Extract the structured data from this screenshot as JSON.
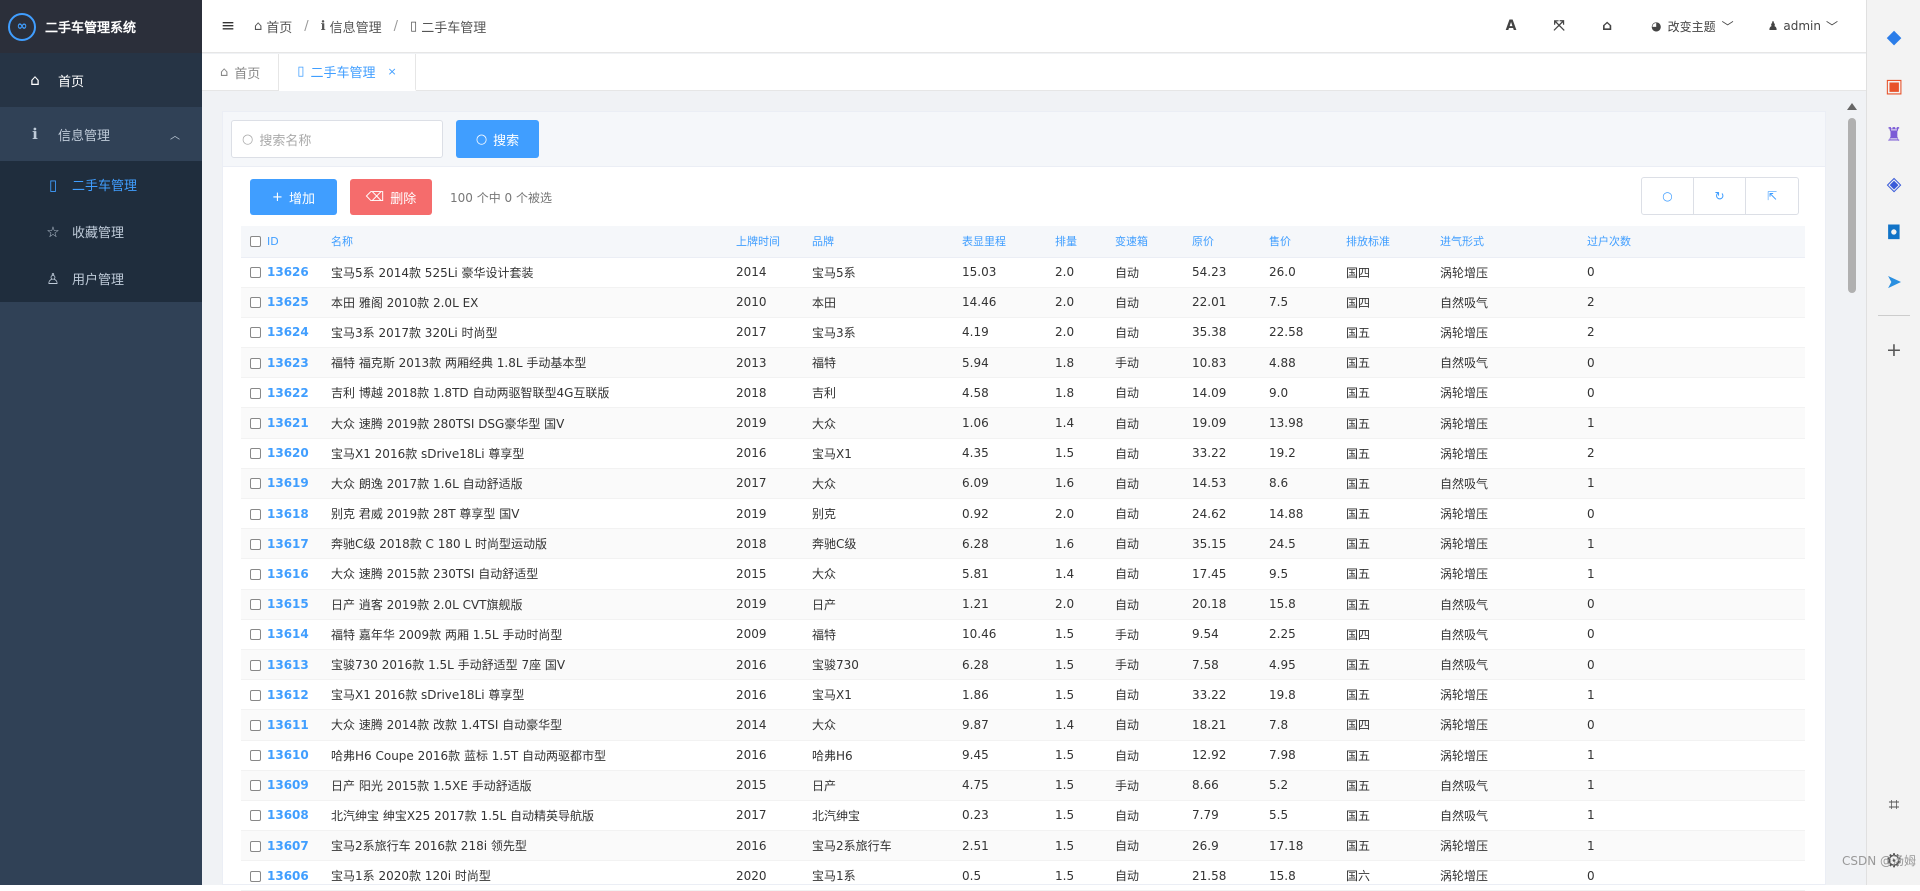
{
  "app": {
    "title": "二手车管理系统",
    "logo_glyph": "∞"
  },
  "sidebar": {
    "items": [
      {
        "label": "首页",
        "icon": "home-icon"
      },
      {
        "label": "信息管理",
        "icon": "info-icon"
      }
    ],
    "subitems": [
      {
        "label": "二手车管理",
        "icon": "file-icon"
      },
      {
        "label": "收藏管理",
        "icon": "star-icon"
      },
      {
        "label": "用户管理",
        "icon": "user-icon"
      }
    ]
  },
  "header": {
    "breadcrumb": [
      "首页",
      "信息管理",
      "二手车管理"
    ],
    "theme_label": "改变主题",
    "user_label": "admin"
  },
  "tabs": [
    {
      "label": "首页"
    },
    {
      "label": "二手车管理"
    }
  ],
  "search": {
    "placeholder": "搜索名称",
    "button_label": "搜索"
  },
  "toolbar": {
    "add_label": "增加",
    "delete_label": "删除",
    "selection_info": "100 个中 0 个被选"
  },
  "table": {
    "columns": [
      "ID",
      "名称",
      "上牌时间",
      "品牌",
      "表显里程",
      "排量",
      "变速箱",
      "原价",
      "售价",
      "排放标准",
      "进气形式",
      "过户次数"
    ],
    "rows": [
      [
        "13626",
        "宝马5系 2014款 525Li 豪华设计套装",
        "2014",
        "宝马5系",
        "15.03",
        "2.0",
        "自动",
        "54.23",
        "26.0",
        "国四",
        "涡轮增压",
        "0"
      ],
      [
        "13625",
        "本田 雅阁 2010款 2.0L EX",
        "2010",
        "本田",
        "14.46",
        "2.0",
        "自动",
        "22.01",
        "7.5",
        "国四",
        "自然吸气",
        "2"
      ],
      [
        "13624",
        "宝马3系 2017款 320Li 时尚型",
        "2017",
        "宝马3系",
        "4.19",
        "2.0",
        "自动",
        "35.38",
        "22.58",
        "国五",
        "涡轮增压",
        "2"
      ],
      [
        "13623",
        "福特 福克斯 2013款 两厢经典 1.8L 手动基本型",
        "2013",
        "福特",
        "5.94",
        "1.8",
        "手动",
        "10.83",
        "4.88",
        "国五",
        "自然吸气",
        "0"
      ],
      [
        "13622",
        "吉利 博越 2018款 1.8TD 自动两驱智联型4G互联版",
        "2018",
        "吉利",
        "4.58",
        "1.8",
        "自动",
        "14.09",
        "9.0",
        "国五",
        "涡轮增压",
        "0"
      ],
      [
        "13621",
        "大众 速腾 2019款 280TSI DSG豪华型 国V",
        "2019",
        "大众",
        "1.06",
        "1.4",
        "自动",
        "19.09",
        "13.98",
        "国五",
        "涡轮增压",
        "1"
      ],
      [
        "13620",
        "宝马X1 2016款 sDrive18Li 尊享型",
        "2016",
        "宝马X1",
        "4.35",
        "1.5",
        "自动",
        "33.22",
        "19.2",
        "国五",
        "涡轮增压",
        "2"
      ],
      [
        "13619",
        "大众 朗逸 2017款 1.6L 自动舒适版",
        "2017",
        "大众",
        "6.09",
        "1.6",
        "自动",
        "14.53",
        "8.6",
        "国五",
        "自然吸气",
        "1"
      ],
      [
        "13618",
        "别克 君威 2019款 28T 尊享型 国V",
        "2019",
        "别克",
        "0.92",
        "2.0",
        "自动",
        "24.62",
        "14.88",
        "国五",
        "涡轮增压",
        "0"
      ],
      [
        "13617",
        "奔驰C级 2018款 C 180 L 时尚型运动版",
        "2018",
        "奔驰C级",
        "6.28",
        "1.6",
        "自动",
        "35.15",
        "24.5",
        "国五",
        "涡轮增压",
        "1"
      ],
      [
        "13616",
        "大众 速腾 2015款 230TSI 自动舒适型",
        "2015",
        "大众",
        "5.81",
        "1.4",
        "自动",
        "17.45",
        "9.5",
        "国五",
        "涡轮增压",
        "1"
      ],
      [
        "13615",
        "日产 逍客 2019款 2.0L CVT旗舰版",
        "2019",
        "日产",
        "1.21",
        "2.0",
        "自动",
        "20.18",
        "15.8",
        "国五",
        "自然吸气",
        "0"
      ],
      [
        "13614",
        "福特 嘉年华 2009款 两厢 1.5L 手动时尚型",
        "2009",
        "福特",
        "10.46",
        "1.5",
        "手动",
        "9.54",
        "2.25",
        "国四",
        "自然吸气",
        "0"
      ],
      [
        "13613",
        "宝骏730 2016款 1.5L 手动舒适型 7座 国V",
        "2016",
        "宝骏730",
        "6.28",
        "1.5",
        "手动",
        "7.58",
        "4.95",
        "国五",
        "自然吸气",
        "0"
      ],
      [
        "13612",
        "宝马X1 2016款 sDrive18Li 尊享型",
        "2016",
        "宝马X1",
        "1.86",
        "1.5",
        "自动",
        "33.22",
        "19.8",
        "国五",
        "涡轮增压",
        "1"
      ],
      [
        "13611",
        "大众 速腾 2014款 改款 1.4TSI 自动豪华型",
        "2014",
        "大众",
        "9.87",
        "1.4",
        "自动",
        "18.21",
        "7.8",
        "国四",
        "涡轮增压",
        "0"
      ],
      [
        "13610",
        "哈弗H6 Coupe 2016款 蓝标 1.5T 自动两驱都市型",
        "2016",
        "哈弗H6",
        "9.45",
        "1.5",
        "自动",
        "12.92",
        "7.98",
        "国五",
        "涡轮增压",
        "1"
      ],
      [
        "13609",
        "日产 阳光 2015款 1.5XE 手动舒适版",
        "2015",
        "日产",
        "4.75",
        "1.5",
        "手动",
        "8.66",
        "5.2",
        "国五",
        "自然吸气",
        "1"
      ],
      [
        "13608",
        "北汽绅宝 绅宝X25 2017款 1.5L 自动精英导航版",
        "2017",
        "北汽绅宝",
        "0.23",
        "1.5",
        "自动",
        "7.79",
        "5.5",
        "国五",
        "自然吸气",
        "1"
      ],
      [
        "13607",
        "宝马2系旅行车 2016款 218i 领先型",
        "2016",
        "宝马2系旅行车",
        "2.51",
        "1.5",
        "自动",
        "26.9",
        "17.18",
        "国五",
        "涡轮增压",
        "1"
      ],
      [
        "13606",
        "宝马1系 2020款 120i 时尚型",
        "2020",
        "宝马1系",
        "0.5",
        "1.5",
        "自动",
        "21.58",
        "15.8",
        "国六",
        "涡轮增压",
        "0"
      ]
    ]
  },
  "watermark": "CSDN @汤姆",
  "colors": {
    "primary": "#409eff",
    "danger": "#f56c6c",
    "sidebar": "#304156"
  }
}
